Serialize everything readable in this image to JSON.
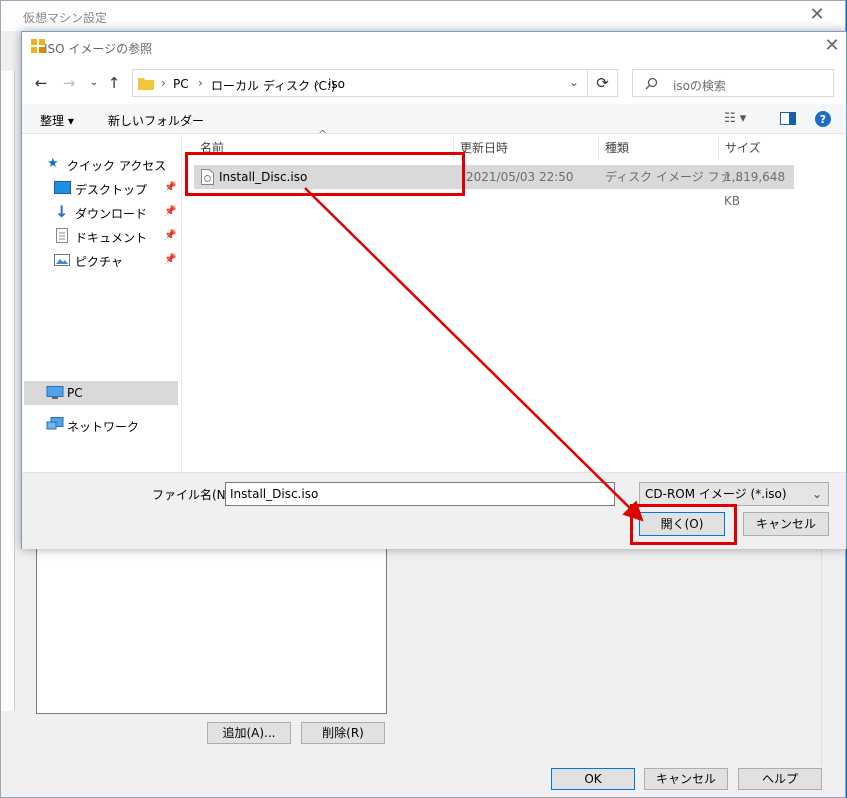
{
  "background_window": {
    "title": "仮想マシン設定",
    "add_button": "追加(A)...",
    "remove_button": "削除(R)",
    "ok_button": "OK",
    "cancel_button": "キャンセル",
    "help_button": "ヘルプ"
  },
  "dialog": {
    "title": "ISO イメージの参照",
    "address": {
      "segments": [
        "PC",
        "ローカル ディスク (C:)",
        "iso"
      ]
    },
    "search_placeholder": "isoの検索",
    "toolbar": {
      "organize": "整理 ▾",
      "new_folder": "新しいフォルダー"
    },
    "nav": {
      "quick_access": "クイック アクセス",
      "desktop": "デスクトップ",
      "downloads": "ダウンロード",
      "documents": "ドキュメント",
      "pictures": "ピクチャ",
      "pc": "PC",
      "network": "ネットワーク"
    },
    "columns": [
      "名前",
      "更新日時",
      "種類",
      "サイズ"
    ],
    "files": [
      {
        "name": "Install_Disc.iso",
        "modified": "2021/05/03 22:50",
        "type": "ディスク イメージ ファ...",
        "size": "1,819,648 KB"
      }
    ],
    "filename_label": "ファイル名(N):",
    "filename_value": "Install_Disc.iso",
    "filter_value": "CD-ROM イメージ (*.iso)",
    "open_button": "開く(O)",
    "cancel_button": "キャンセル"
  },
  "colors": {
    "highlight": "#e00000",
    "accent": "#0078d7",
    "desktop": "#1565b0"
  }
}
